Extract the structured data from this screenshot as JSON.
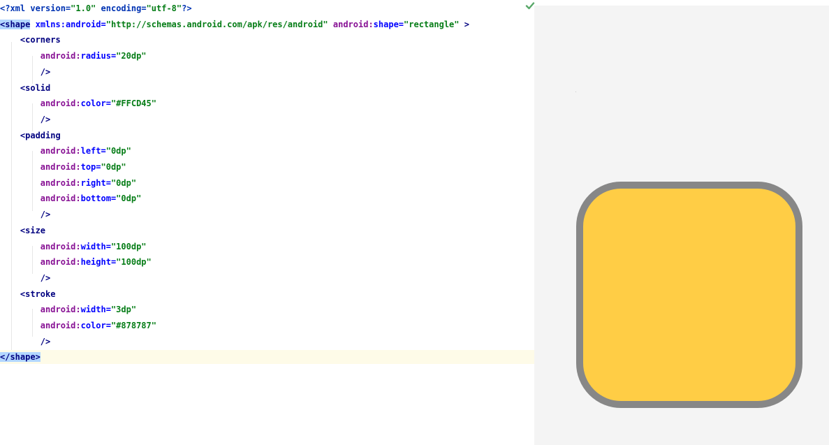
{
  "editor": {
    "lines": [
      {
        "parts": [
          {
            "cls": "t-pi",
            "text": "<?xml "
          },
          {
            "cls": "t-pi",
            "text": "version="
          },
          {
            "cls": "t-val",
            "text": "\"1.0\""
          },
          {
            "cls": "t-plain",
            "text": " "
          },
          {
            "cls": "t-pi",
            "text": "encoding="
          },
          {
            "cls": "t-val",
            "text": "\"utf-8\""
          },
          {
            "cls": "t-pi",
            "text": "?>"
          }
        ]
      },
      {
        "parts": [
          {
            "cls": "t-bracket tag-hl",
            "text": "<shape"
          },
          {
            "cls": "t-plain",
            "text": " "
          },
          {
            "cls": "t-attr",
            "text": "xmlns:android="
          },
          {
            "cls": "t-val",
            "text": "\"http://schemas.android.com/apk/res/android\""
          },
          {
            "cls": "t-plain",
            "text": " "
          },
          {
            "cls": "t-attr-ns",
            "text": "android:"
          },
          {
            "cls": "t-attr",
            "text": "shape="
          },
          {
            "cls": "t-val",
            "text": "\"rectangle\""
          },
          {
            "cls": "t-bracket",
            "text": " >"
          }
        ]
      },
      {
        "parts": [
          {
            "cls": "t-plain",
            "text": "    "
          },
          {
            "cls": "t-bracket",
            "text": "<corners"
          }
        ]
      },
      {
        "parts": [
          {
            "cls": "t-plain",
            "text": "        "
          },
          {
            "cls": "t-attr-ns",
            "text": "android:"
          },
          {
            "cls": "t-attr",
            "text": "radius="
          },
          {
            "cls": "t-val",
            "text": "\"20dp\""
          }
        ]
      },
      {
        "parts": [
          {
            "cls": "t-plain",
            "text": "        "
          },
          {
            "cls": "t-bracket",
            "text": "/>"
          }
        ]
      },
      {
        "parts": [
          {
            "cls": "t-plain",
            "text": "    "
          },
          {
            "cls": "t-bracket",
            "text": "<solid"
          }
        ]
      },
      {
        "parts": [
          {
            "cls": "t-plain",
            "text": "        "
          },
          {
            "cls": "t-attr-ns",
            "text": "android:"
          },
          {
            "cls": "t-attr",
            "text": "color="
          },
          {
            "cls": "t-val",
            "text": "\"#FFCD45\""
          }
        ]
      },
      {
        "parts": [
          {
            "cls": "t-plain",
            "text": "        "
          },
          {
            "cls": "t-bracket",
            "text": "/>"
          }
        ]
      },
      {
        "parts": [
          {
            "cls": "t-plain",
            "text": "    "
          },
          {
            "cls": "t-bracket",
            "text": "<padding"
          }
        ]
      },
      {
        "parts": [
          {
            "cls": "t-plain",
            "text": "        "
          },
          {
            "cls": "t-attr-ns",
            "text": "android:"
          },
          {
            "cls": "t-attr",
            "text": "left="
          },
          {
            "cls": "t-val",
            "text": "\"0dp\""
          }
        ]
      },
      {
        "parts": [
          {
            "cls": "t-plain",
            "text": "        "
          },
          {
            "cls": "t-attr-ns",
            "text": "android:"
          },
          {
            "cls": "t-attr",
            "text": "top="
          },
          {
            "cls": "t-val",
            "text": "\"0dp\""
          }
        ]
      },
      {
        "parts": [
          {
            "cls": "t-plain",
            "text": "        "
          },
          {
            "cls": "t-attr-ns",
            "text": "android:"
          },
          {
            "cls": "t-attr",
            "text": "right="
          },
          {
            "cls": "t-val",
            "text": "\"0dp\""
          }
        ]
      },
      {
        "parts": [
          {
            "cls": "t-plain",
            "text": "        "
          },
          {
            "cls": "t-attr-ns",
            "text": "android:"
          },
          {
            "cls": "t-attr",
            "text": "bottom="
          },
          {
            "cls": "t-val",
            "text": "\"0dp\""
          }
        ]
      },
      {
        "parts": [
          {
            "cls": "t-plain",
            "text": "        "
          },
          {
            "cls": "t-bracket",
            "text": "/>"
          }
        ]
      },
      {
        "parts": [
          {
            "cls": "t-plain",
            "text": "    "
          },
          {
            "cls": "t-bracket",
            "text": "<size"
          }
        ]
      },
      {
        "parts": [
          {
            "cls": "t-plain",
            "text": "        "
          },
          {
            "cls": "t-attr-ns",
            "text": "android:"
          },
          {
            "cls": "t-attr",
            "text": "width="
          },
          {
            "cls": "t-val",
            "text": "\"100dp\""
          }
        ]
      },
      {
        "parts": [
          {
            "cls": "t-plain",
            "text": "        "
          },
          {
            "cls": "t-attr-ns",
            "text": "android:"
          },
          {
            "cls": "t-attr",
            "text": "height="
          },
          {
            "cls": "t-val",
            "text": "\"100dp\""
          }
        ]
      },
      {
        "parts": [
          {
            "cls": "t-plain",
            "text": "        "
          },
          {
            "cls": "t-bracket",
            "text": "/>"
          }
        ]
      },
      {
        "parts": [
          {
            "cls": "t-plain",
            "text": "    "
          },
          {
            "cls": "t-bracket",
            "text": "<stroke"
          }
        ]
      },
      {
        "parts": [
          {
            "cls": "t-plain",
            "text": "        "
          },
          {
            "cls": "t-attr-ns",
            "text": "android:"
          },
          {
            "cls": "t-attr",
            "text": "width="
          },
          {
            "cls": "t-val",
            "text": "\"3dp\""
          }
        ]
      },
      {
        "parts": [
          {
            "cls": "t-plain",
            "text": "        "
          },
          {
            "cls": "t-attr-ns",
            "text": "android:"
          },
          {
            "cls": "t-attr",
            "text": "color="
          },
          {
            "cls": "t-val",
            "text": "\"#878787\""
          }
        ]
      },
      {
        "parts": [
          {
            "cls": "t-plain",
            "text": "        "
          },
          {
            "cls": "t-bracket",
            "text": "/>"
          }
        ]
      },
      {
        "parts": [
          {
            "cls": "t-bracket tag-hl",
            "text": "</shape>"
          }
        ],
        "current": true
      }
    ],
    "status_icon": "check-icon"
  },
  "preview": {
    "shape_fill": "#FFCD45",
    "shape_stroke": "#878787"
  }
}
